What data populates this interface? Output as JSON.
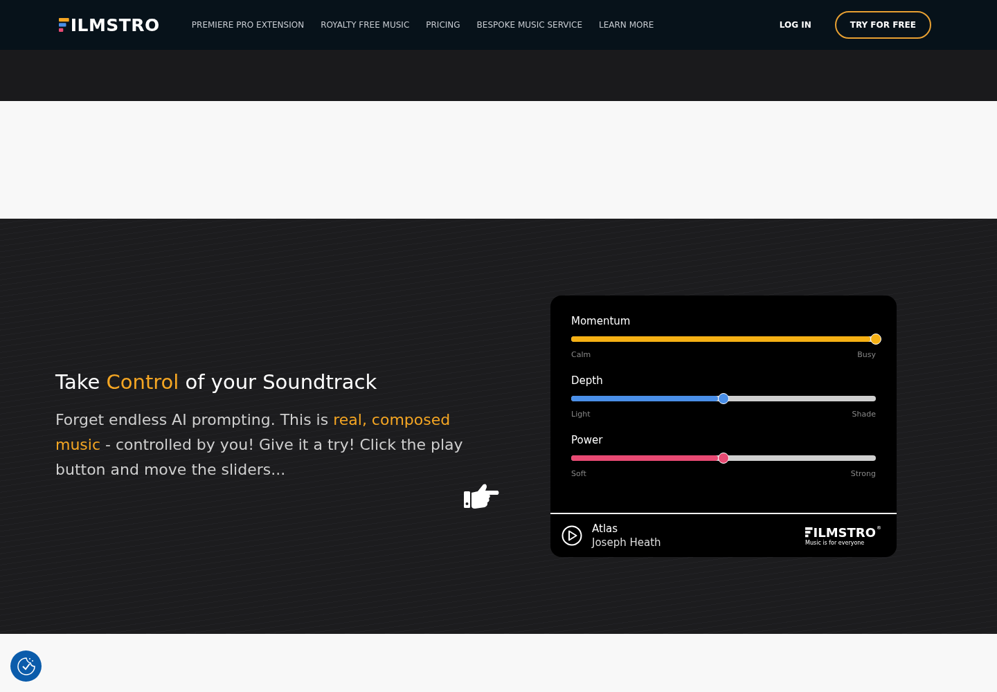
{
  "header": {
    "logo": "ILMSTRO",
    "nav": [
      "PREMIERE PRO EXTENSION",
      "ROYALTY FREE MUSIC",
      "PRICING",
      "BESPOKE MUSIC SERVICE",
      "LEARN MORE"
    ],
    "login": "LOG IN",
    "cta": "TRY FOR FREE"
  },
  "hero": {
    "title": [
      {
        "text": "Take ",
        "highlight": false
      },
      {
        "text": "Control",
        "highlight": true
      },
      {
        "text": " of your Soundtrack",
        "highlight": false
      }
    ],
    "body": [
      {
        "text": "Forget endless AI prompting. This is ",
        "highlight": false
      },
      {
        "text": "real, composed music",
        "highlight": true
      },
      {
        "text": " - controlled by you! Give it a try! Click the play button and move the sliders...",
        "highlight": false
      }
    ]
  },
  "player": {
    "sliders": [
      {
        "name": "Momentum",
        "level": 1.0,
        "color": "#f5b014",
        "min_label": "Calm",
        "max_label": "Busy"
      },
      {
        "name": "Depth",
        "level": 0.5,
        "color": "#4a8fe8",
        "min_label": "Light",
        "max_label": "Shade"
      },
      {
        "name": "Power",
        "level": 0.5,
        "color": "#e84a73",
        "min_label": "Soft",
        "max_label": "Strong"
      }
    ],
    "track": "Atlas",
    "artist": "Joseph Heath",
    "brand": "ILMSTRO",
    "brand_mark": "®",
    "tagline": "Music is for everyone"
  }
}
